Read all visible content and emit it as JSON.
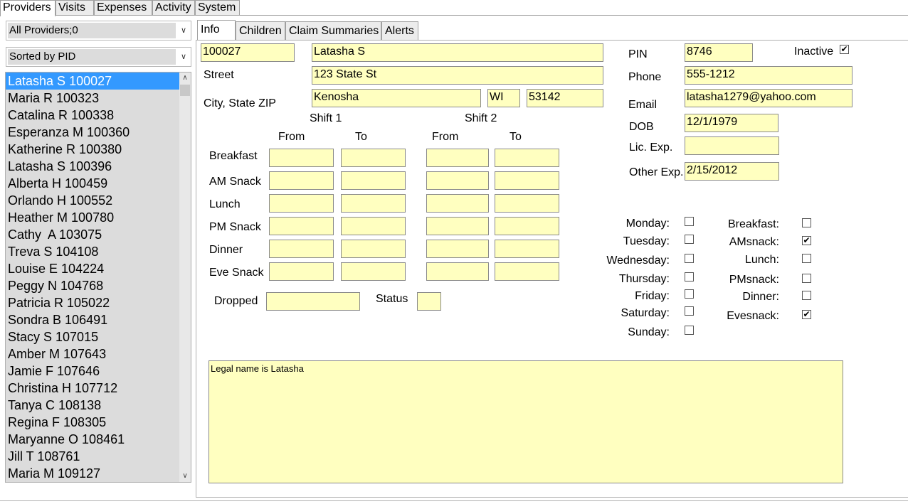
{
  "top_tabs": [
    {
      "label": "Providers"
    },
    {
      "label": "Visits"
    },
    {
      "label": "Expenses"
    },
    {
      "label": "Activity"
    },
    {
      "label": "System"
    }
  ],
  "filter": {
    "value": "All Providers;0"
  },
  "sort": {
    "value": "Sorted by PID"
  },
  "providers": [
    "Latasha S 100027",
    "Maria R 100323",
    "Catalina R 100338",
    "Esperanza M 100360",
    "Katherine R 100380",
    "Latasha S 100396",
    "Alberta H 100459",
    "Orlando H 100552",
    "Heather M 100780",
    "Cathy  A 103075",
    "Treva S 104108",
    "Louise E 104224",
    "Peggy N 104768",
    "Patricia R 105022",
    "Sondra B 106491",
    "Stacy S 107015",
    "Amber M 107643",
    "Jamie F 107646",
    "Christina H 107712",
    "Tanya C 108138",
    "Regina F 108305",
    "Maryanne O 108461",
    "Jill T 108761",
    "Maria M 109127"
  ],
  "sub_tabs": [
    {
      "label": "Info"
    },
    {
      "label": "Children"
    },
    {
      "label": "Claim Summaries"
    },
    {
      "label": "Alerts"
    }
  ],
  "info": {
    "pid": "100027",
    "name": "Latasha S",
    "street_label": "Street",
    "street": "123 State St",
    "city_label": "City, State ZIP",
    "city": "Kenosha",
    "state": "WI",
    "zip": "53142",
    "pin_label": "PIN",
    "pin": "8746",
    "inactive_label": "Inactive",
    "inactive": true,
    "phone_label": "Phone",
    "phone": "555-1212",
    "email_label": "Email",
    "email": "latasha1279@yahoo.com",
    "dob_label": "DOB",
    "dob": "12/1/1979",
    "lic_exp_label": "Lic. Exp.",
    "lic_exp": "",
    "other_exp_label": "Other Exp.",
    "other_exp": "2/15/2012",
    "shift1_label": "Shift 1",
    "shift2_label": "Shift 2",
    "from_label": "From",
    "to_label": "To",
    "meals": [
      "Breakfast",
      "AM Snack",
      "Lunch",
      "PM Snack",
      "Dinner",
      "Eve Snack"
    ],
    "dropped_label": "Dropped",
    "dropped": "",
    "status_label": "Status",
    "status": "",
    "days": [
      {
        "label": "Monday:",
        "checked": false
      },
      {
        "label": "Tuesday:",
        "checked": false
      },
      {
        "label": "Wednesday:",
        "checked": false
      },
      {
        "label": "Thursday:",
        "checked": false
      },
      {
        "label": "Friday:",
        "checked": false
      },
      {
        "label": "Saturday:",
        "checked": false
      },
      {
        "label": "Sunday:",
        "checked": false
      }
    ],
    "meal_flags": [
      {
        "label": "Breakfast:",
        "checked": false
      },
      {
        "label": "AMsnack:",
        "checked": true
      },
      {
        "label": "Lunch:",
        "checked": false
      },
      {
        "label": "PMsnack:",
        "checked": false
      },
      {
        "label": "Dinner:",
        "checked": false
      },
      {
        "label": "Evesnack:",
        "checked": true
      }
    ],
    "notes": "Legal name is Latasha"
  },
  "icons": {
    "dropdown": "chevron-down-icon",
    "scroll_up": "scroll-up-icon",
    "scroll_down": "scroll-down-icon",
    "check": "checkmark-icon"
  },
  "colors": {
    "field_bg": "#ffffc0",
    "selection": "#3399ff",
    "list_bg": "#dcdcdc"
  }
}
